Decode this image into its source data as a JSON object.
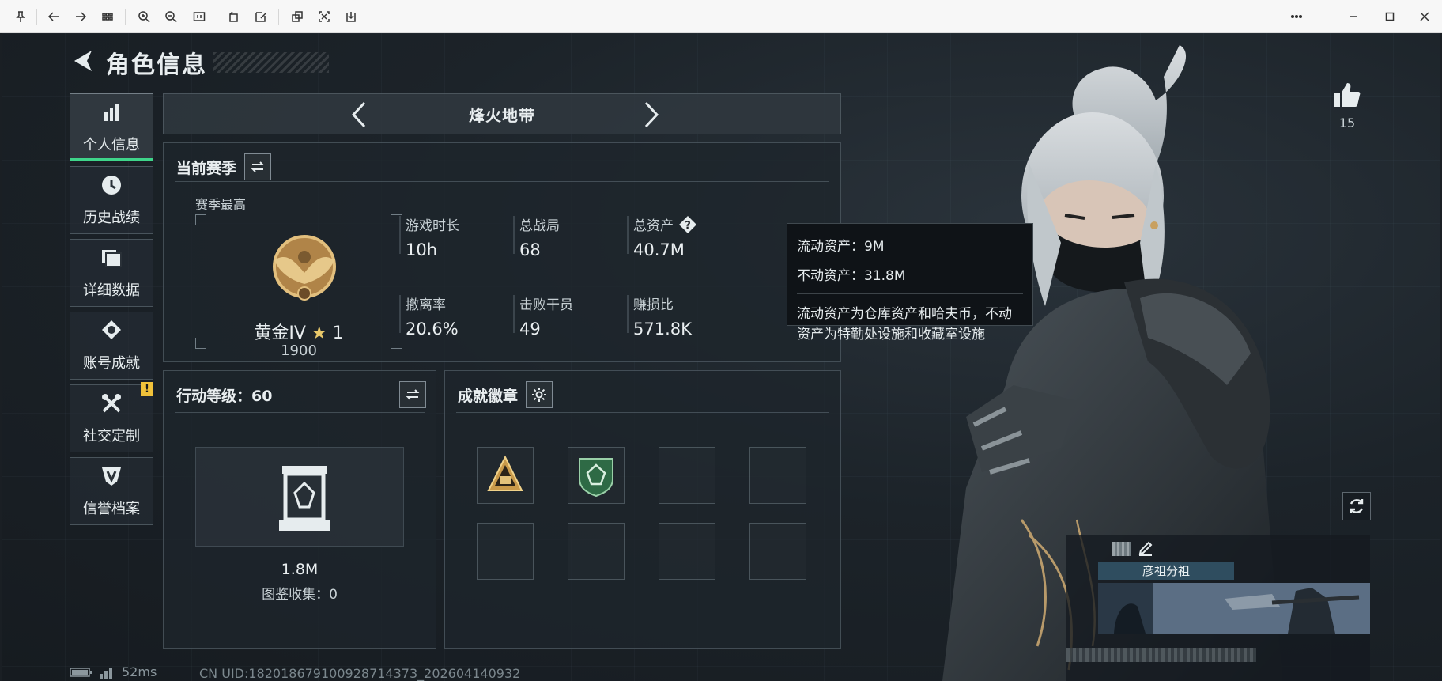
{
  "window": {
    "toolbar_icons": [
      "pin-icon",
      "back-icon",
      "forward-icon",
      "grid-icon",
      "zoom-in-icon",
      "zoom-out-icon",
      "fit-icon",
      "rotate-icon",
      "edit-icon",
      "crop-icon",
      "screenshot-icon",
      "save-icon",
      "more-icon",
      "minimize-icon",
      "maximize-icon",
      "close-icon"
    ]
  },
  "header": {
    "title": "角色信息"
  },
  "nav": {
    "items": [
      {
        "label": "个人信息",
        "icon": "bar-chart-icon",
        "active": true
      },
      {
        "label": "历史战绩",
        "icon": "clock-icon"
      },
      {
        "label": "详细数据",
        "icon": "folder-icon"
      },
      {
        "label": "账号成就",
        "icon": "medal-icon"
      },
      {
        "label": "社交定制",
        "icon": "tools-icon",
        "warning": "!"
      },
      {
        "label": "信誉档案",
        "icon": "shield-icon"
      }
    ]
  },
  "mode": {
    "label": "烽火地带"
  },
  "season": {
    "title": "当前赛季",
    "best_label": "赛季最高",
    "rank_name": "黄金IV",
    "rank_star": "★",
    "rank_stars": "1",
    "rank_score": "1900",
    "stats": [
      {
        "label": "游戏时长",
        "value": "10h"
      },
      {
        "label": "总战局",
        "value": "68"
      },
      {
        "label": "总资产",
        "value": "40.7M"
      },
      {
        "label": "撤离率",
        "value": "20.6%"
      },
      {
        "label": "击败干员",
        "value": "49"
      },
      {
        "label": "赚损比",
        "value": "571.8K"
      }
    ]
  },
  "tooltip": {
    "liquid": "流动资产：9M",
    "fixed": "不动资产：31.8M",
    "desc": "流动资产为仓库资产和哈夫币，不动资产为特勤处设施和收藏室设施"
  },
  "level": {
    "title": "行动等级：60",
    "value": "1.8M",
    "collection": "图鉴收集：0"
  },
  "badges": {
    "title": "成就徽章"
  },
  "likes": {
    "count": "15"
  },
  "card": {
    "clan": "彦祖分祖"
  },
  "footer": {
    "ping": "52ms",
    "uid": "CN UID:18201867910092871437​3_202604140932"
  },
  "colors": {
    "accent_green": "#3fd58a",
    "warning": "#f0c13a",
    "gold": "#c99a4a"
  }
}
